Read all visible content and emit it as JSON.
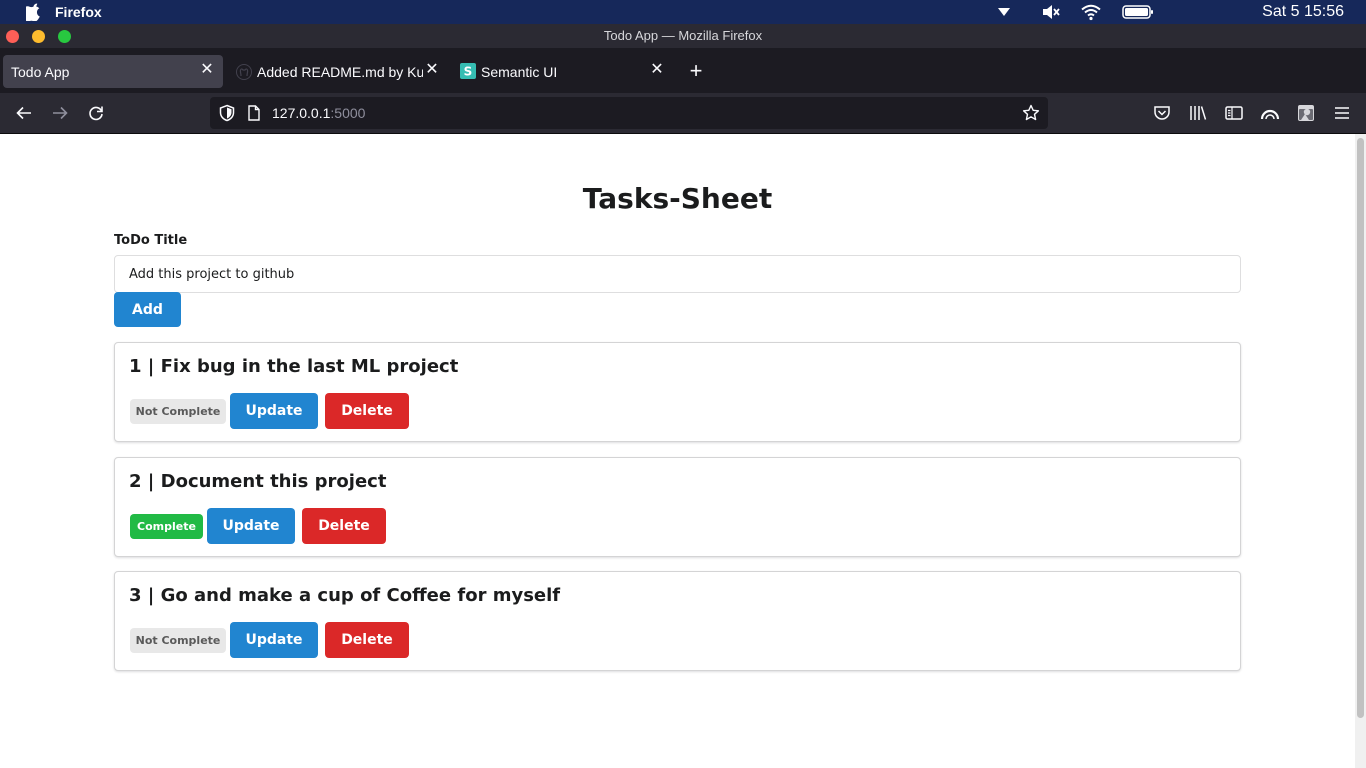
{
  "os_menubar": {
    "app_name": "Firefox",
    "clock": "Sat 5  15:56"
  },
  "window": {
    "title": "Todo App — Mozilla Firefox"
  },
  "tabs": [
    {
      "label": "Todo App",
      "active": true
    },
    {
      "label": "Added README.md by Kun",
      "active": false
    },
    {
      "label": "Semantic UI",
      "active": false
    }
  ],
  "navbar": {
    "url_host": "127.0.0.1",
    "url_port": ":5000"
  },
  "page": {
    "title": "Tasks-Sheet",
    "form": {
      "label": "ToDo Title",
      "input_value": "Add this project to github",
      "add_label": "Add"
    },
    "tasks": [
      {
        "title": "1 | Fix bug in the last ML project",
        "status": "Not Complete",
        "complete": false,
        "update_label": "Update",
        "delete_label": "Delete"
      },
      {
        "title": "2 | Document this project",
        "status": "Complete",
        "complete": true,
        "update_label": "Update",
        "delete_label": "Delete"
      },
      {
        "title": "3 | Go and make a cup of Coffee for myself",
        "status": "Not Complete",
        "complete": false,
        "update_label": "Update",
        "delete_label": "Delete"
      }
    ]
  },
  "colors": {
    "primary": "#2185d0",
    "danger": "#db2828",
    "success": "#21ba45",
    "menubar": "#16285a",
    "browser_chrome": "#2b2a33"
  }
}
